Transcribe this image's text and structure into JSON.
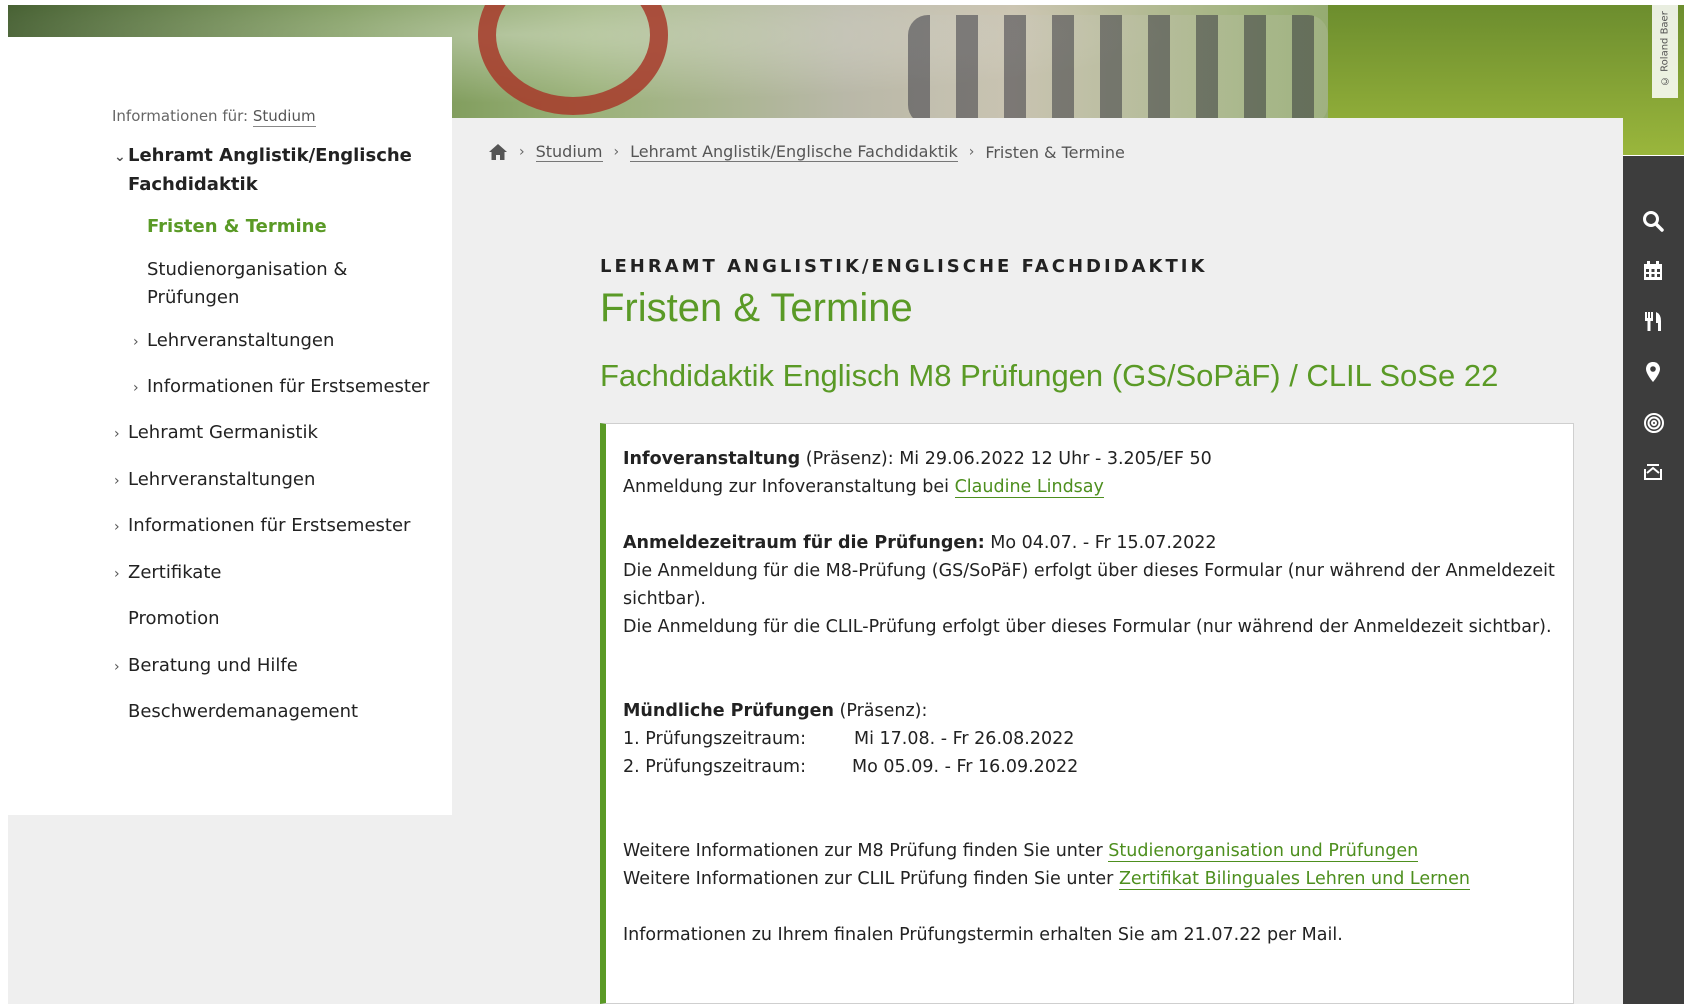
{
  "hero": {
    "photo_credit": "© Roland Baer"
  },
  "sidebar": {
    "info_for_label": "Informationen für:",
    "info_for_link": "Studium",
    "items": [
      {
        "label": "Lehramt Anglistik/Englische",
        "label2": "Fachdidaktik",
        "chevron": "⌄"
      },
      {
        "label": "Fristen & Termine"
      },
      {
        "label": "Studienorganisation &",
        "label2": "Prüfungen"
      },
      {
        "label": "Lehrveranstaltungen",
        "chevron": "›"
      },
      {
        "label": "Informationen für Erstsemester",
        "chevron": "›"
      },
      {
        "label": "Lehramt Germanistik",
        "chevron": "›"
      },
      {
        "label": "Lehrveranstaltungen",
        "chevron": "›"
      },
      {
        "label": "Informationen für Erstsemester",
        "chevron": "›"
      },
      {
        "label": "Zertifikate",
        "chevron": "›"
      },
      {
        "label": "Promotion"
      },
      {
        "label": "Beratung und Hilfe",
        "chevron": "›"
      },
      {
        "label": "Beschwerdemanagement"
      }
    ]
  },
  "breadcrumb": {
    "sep": "›",
    "items": [
      "Studium",
      "Lehramt Anglistik/Englische Fachdidaktik",
      "Fristen & Termine"
    ]
  },
  "main": {
    "kicker": "LEHRAMT ANGLISTIK/ENGLISCHE FACHDIDAKTIK",
    "title": "Fristen & Termine",
    "section_title": "Fachdidaktik Englisch M8 Prüfungen (GS/SoPäF) / CLIL SoSe 22",
    "box": {
      "info_bold": "Infoveranstaltung",
      "info_rest": " (Präsenz): Mi 29.06.2022 12 Uhr - 3.205/EF 50",
      "anmeldung_info": "Anmeldung zur Infoveranstaltung bei ",
      "contact_link": "Claudine Lindsay",
      "anmeldezeitraum_bold": "Anmeldezeitraum für die Prüfungen:",
      "anmeldezeitraum_rest": " Mo 04.07. - Fr 15.07.2022",
      "m8_line1": "Die Anmeldung für die M8-Prüfung (GS/SoPäF) erfolgt über dieses Formular (nur während der Anmeldezeit",
      "m8_line2": "sichtbar).",
      "clil_line": "Die Anmeldung für die CLIL-Prüfung erfolgt über dieses Formular (nur während der Anmeldezeit sichtbar).",
      "muendlich_bold": "Mündliche Prüfungen",
      "muendlich_rest": " (Präsenz):",
      "pz1_label": "1. Prüfungszeitraum:",
      "pz1_value": "Mi 17.08. - Fr 26.08.2022",
      "pz2_label": "2. Prüfungszeitraum:",
      "pz2_value": "Mo 05.09. - Fr 16.09.2022",
      "weitere_m8": "Weitere Informationen zur M8 Prüfung finden Sie unter ",
      "weitere_m8_link": "Studienorganisation und Prüfungen",
      "weitere_clil": "Weitere Informationen zur CLIL Prüfung finden Sie unter ",
      "weitere_clil_link": "Zertifikat Bilinguales Lehren und Lernen",
      "final_info": "Informationen zu Ihrem finalen Prüfungstermin erhalten Sie am 21.07.22 per Mail."
    }
  },
  "right_bar": {
    "icons": [
      "search-icon",
      "calendar-icon",
      "cutlery-icon",
      "location-pin-icon",
      "wifi-icon",
      "mail-icon"
    ]
  },
  "colors": {
    "accent_green": "#5a9a26",
    "dark_bar": "#3d3d3d",
    "page_bg": "#efefef"
  }
}
